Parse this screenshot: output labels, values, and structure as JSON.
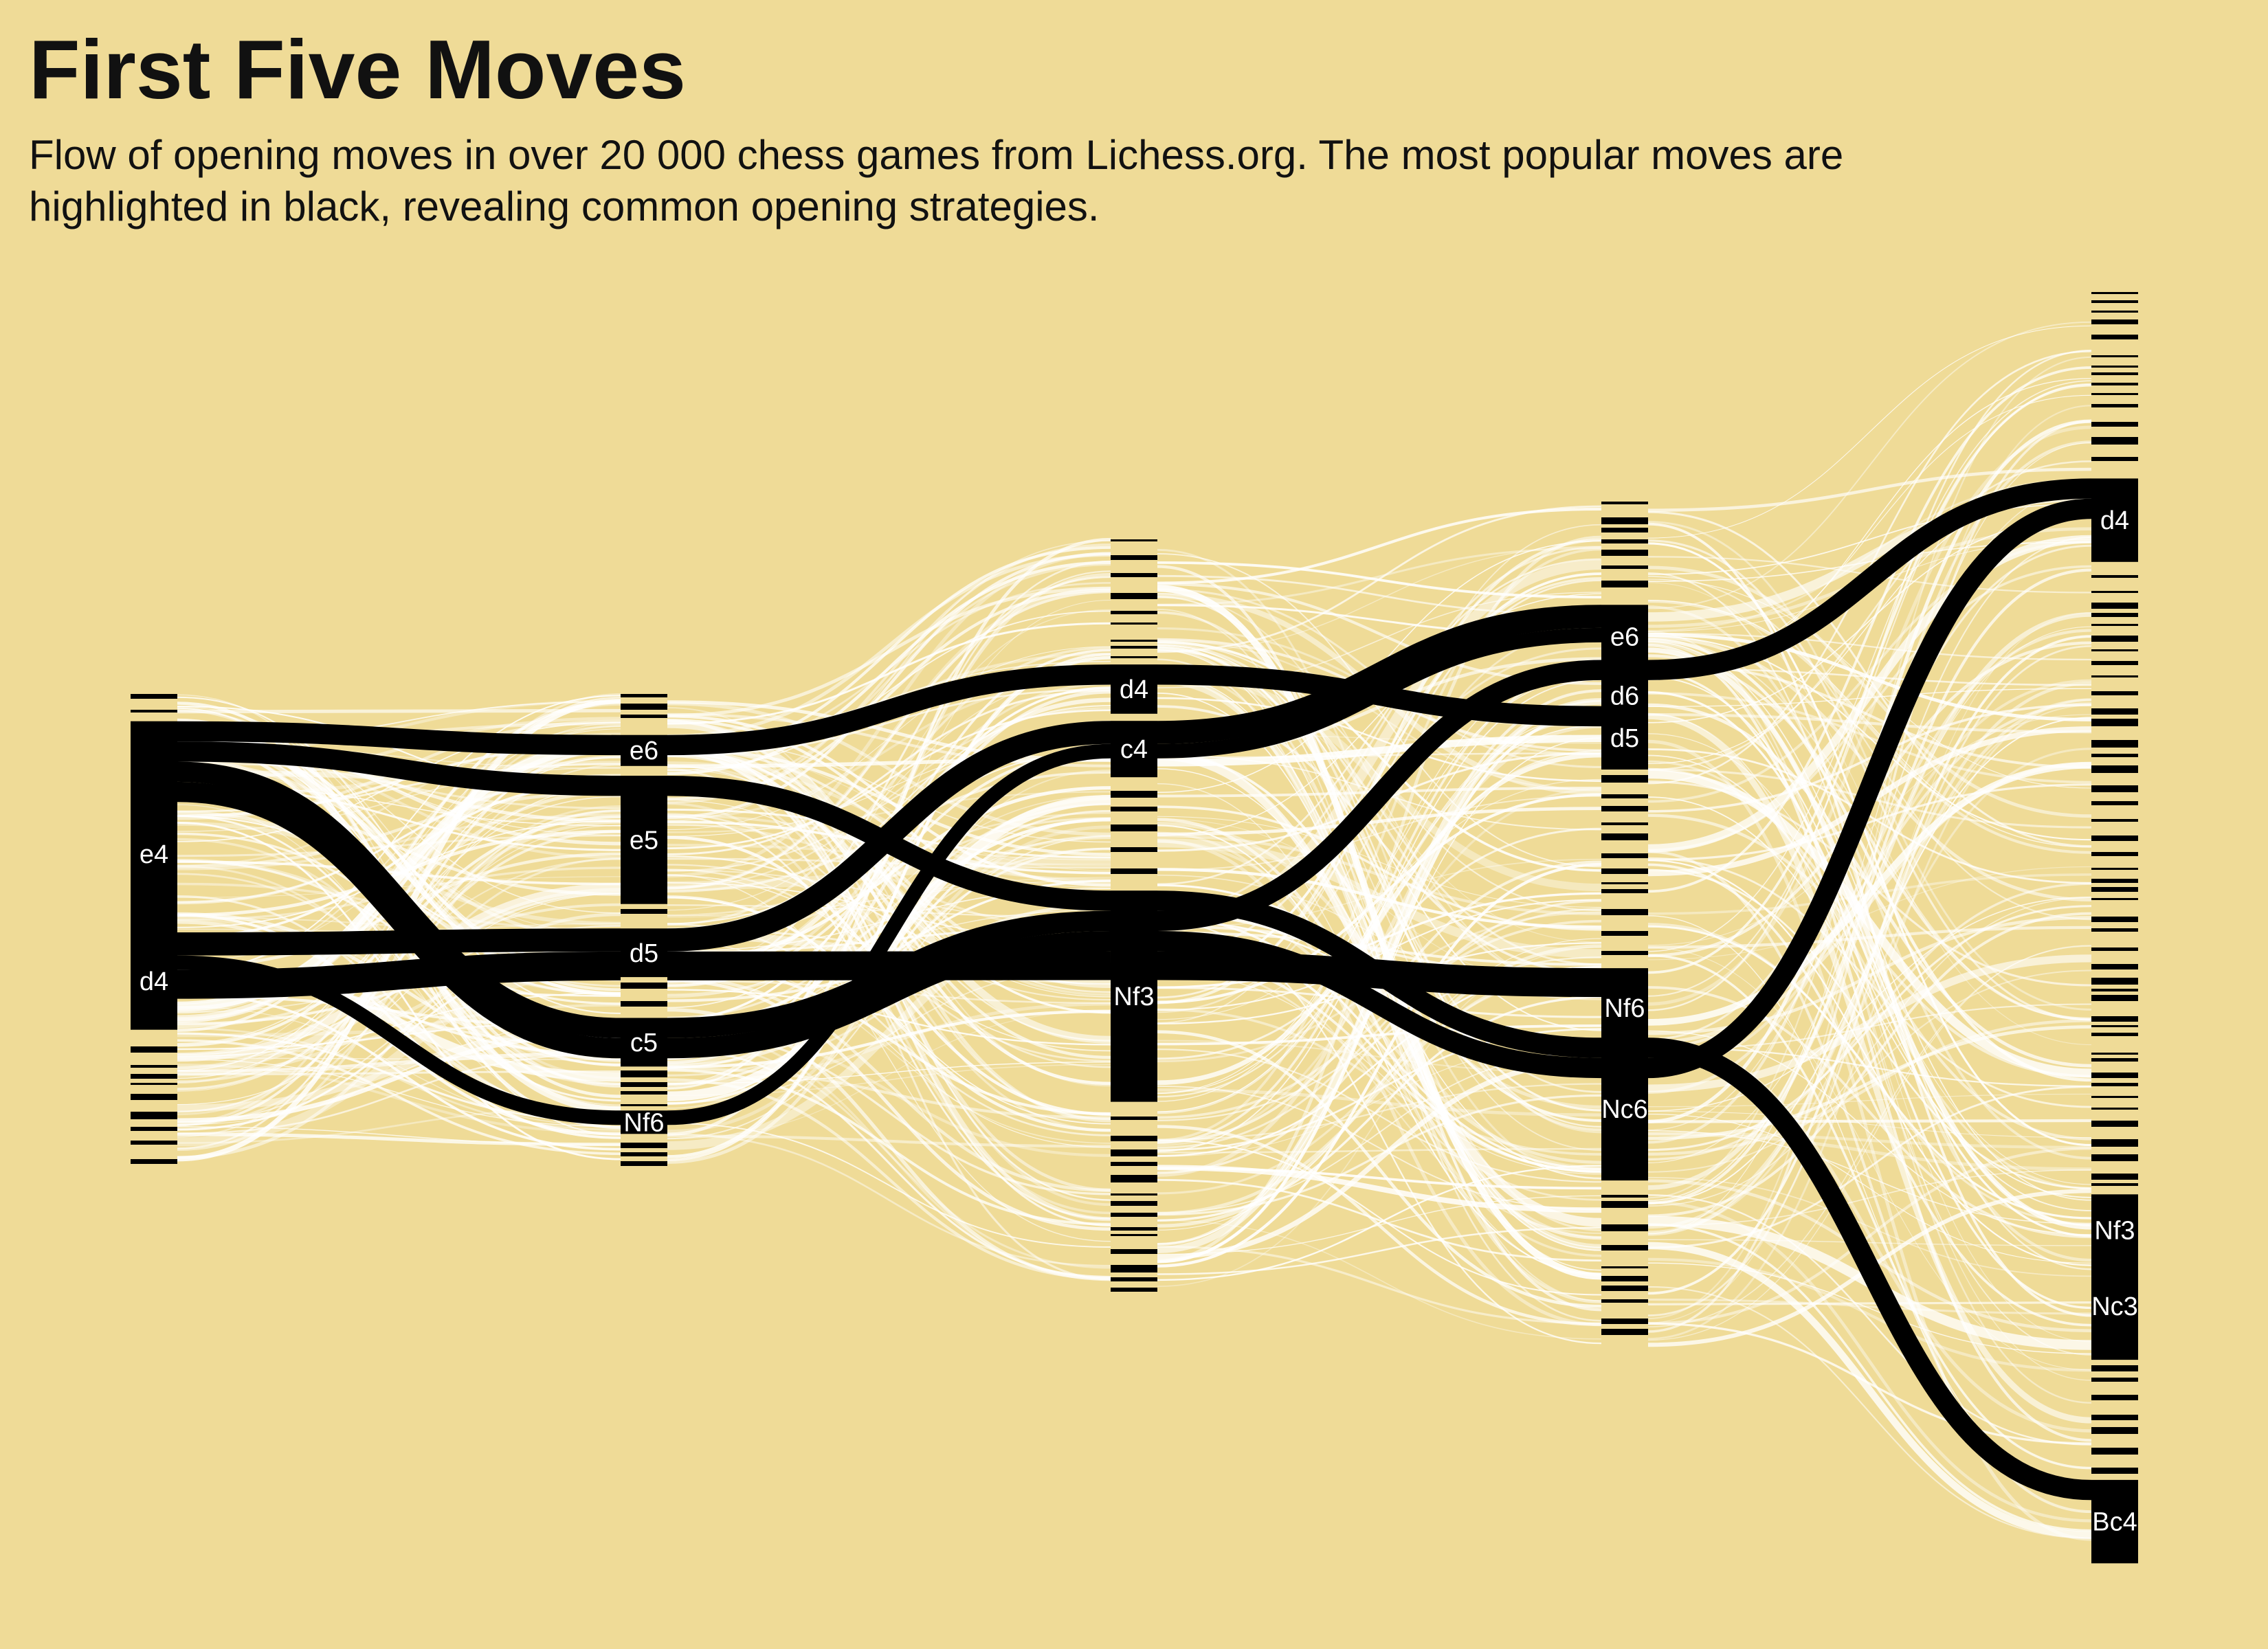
{
  "title": "First Five Moves",
  "subtitle": "Flow of opening moves in over 20 000 chess games from Lichess.org. The most popular moves are highlighted in black, revealing common opening strategies.",
  "colors": {
    "background": "#efdb97",
    "highlight": "#000000",
    "other_flows": "#ffffff"
  },
  "chart_data": {
    "type": "sankey",
    "title": "First Five Moves",
    "subtitle": "Flow of opening moves in over 20 000 chess games from Lichess.org. The most popular moves are highlighted in black, revealing common opening strategies.",
    "stages": [
      {
        "labeled_nodes": [
          {
            "move": "e4",
            "share": 0.6
          },
          {
            "move": "d4",
            "share": 0.22
          }
        ],
        "other_share": 0.18
      },
      {
        "labeled_nodes": [
          {
            "move": "e6",
            "share": 0.07
          },
          {
            "move": "e5",
            "share": 0.29
          },
          {
            "move": "d5",
            "share": 0.11
          },
          {
            "move": "c5",
            "share": 0.11
          },
          {
            "move": "Nf6",
            "share": 0.05
          }
        ],
        "other_share": 0.37
      },
      {
        "labeled_nodes": [
          {
            "move": "d4",
            "share": 0.07
          },
          {
            "move": "c4",
            "share": 0.08
          },
          {
            "move": "Nf3",
            "share": 0.3
          }
        ],
        "other_share": 0.55
      },
      {
        "labeled_nodes": [
          {
            "move": "e6",
            "share": 0.08
          },
          {
            "move": "d6",
            "share": 0.09
          },
          {
            "move": "d5",
            "share": 0.08
          },
          {
            "move": "Nf6",
            "share": 0.1
          },
          {
            "move": "Nc6",
            "share": 0.18
          }
        ],
        "other_share": 0.47
      },
      {
        "labeled_nodes": [
          {
            "move": "d4",
            "share": 0.07
          },
          {
            "move": "Nf3",
            "share": 0.06
          },
          {
            "move": "Nc3",
            "share": 0.09
          },
          {
            "move": "Bc4",
            "share": 0.07
          }
        ],
        "other_share": 0.71
      }
    ],
    "highlighted_paths": [
      [
        "e4",
        "e6",
        "d4",
        "d5"
      ],
      [
        "e4",
        "e5",
        "Nf3",
        "Nc6",
        "Bc4"
      ],
      [
        "e4",
        "c5",
        "Nf3",
        "d6",
        "d4"
      ],
      [
        "e4",
        "c5",
        "Nf3",
        "Nc6",
        "d4"
      ],
      [
        "d4",
        "d5",
        "c4",
        "e6"
      ],
      [
        "d4",
        "Nf6",
        "c4",
        "e6"
      ],
      [
        "d4",
        "d5",
        "Nf3",
        "Nf6"
      ]
    ],
    "legend": "none"
  }
}
